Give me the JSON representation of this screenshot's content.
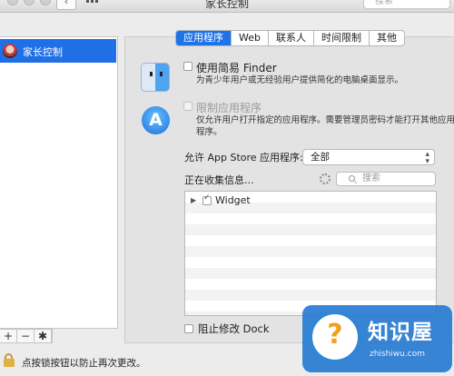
{
  "window": {
    "title": "家长控制",
    "search_placeholder": "搜索",
    "back_label": "‹",
    "forward_label": "›"
  },
  "sidebar": {
    "items": [
      {
        "label": "家长控制",
        "selected": true
      }
    ],
    "toolbar": {
      "add": "+",
      "remove": "−",
      "gear": "✱"
    }
  },
  "tabs": [
    {
      "label": "应用程序",
      "active": true
    },
    {
      "label": "Web",
      "active": false
    },
    {
      "label": "联系人",
      "active": false
    },
    {
      "label": "时间限制",
      "active": false
    },
    {
      "label": "其他",
      "active": false
    }
  ],
  "apps": {
    "simple_finder": {
      "label": "使用简易 Finder",
      "description": "为青少年用户或无经验用户提供简化的电脑桌面显示。",
      "checked": false,
      "icon": "finder-icon"
    },
    "limit_apps": {
      "label": "限制应用程序",
      "description_line1": "仅允许用户打开指定的应用程序。需要管理员密码才能打开其他应用",
      "description_line2": "程序。",
      "checked": false,
      "enabled": false,
      "icon": "app-store-icon",
      "icon_glyph": "A"
    },
    "allow_store_label": "允许 App Store 应用程序:",
    "allow_store_value": "全部",
    "collecting_label": "正在收集信息...",
    "list_search_placeholder": "搜索",
    "list_items": [
      {
        "name": "Widget",
        "checked": true
      }
    ],
    "prevent_dock_label": "阻止修改 Dock",
    "prevent_dock_checked": false
  },
  "footer": {
    "lock_text": "点按锁按钮以防止再次更改。"
  },
  "watermark": {
    "title": "知识屋",
    "url": "zhishiwu.com",
    "glyph": "?",
    "color": "#2378d2"
  }
}
